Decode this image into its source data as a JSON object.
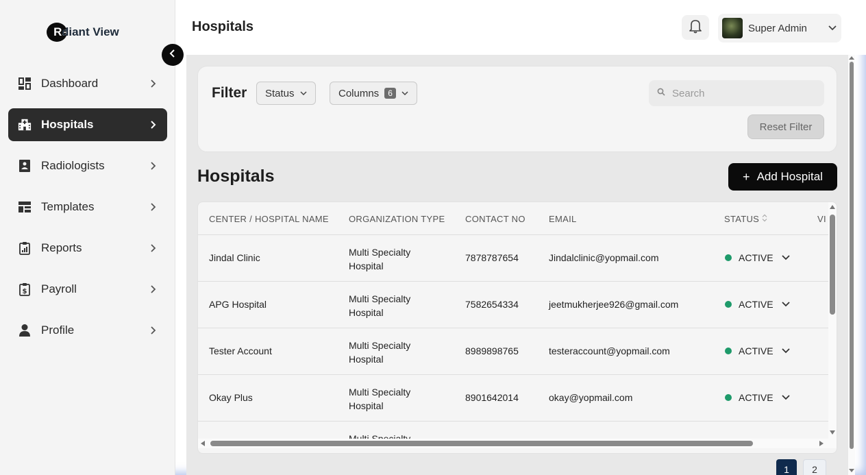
{
  "app": {
    "logo_badge": "Ra",
    "logo_rest": "diant View"
  },
  "sidebar": {
    "items": [
      {
        "label": "Dashboard",
        "icon": "dashboard-icon"
      },
      {
        "label": "Hospitals",
        "icon": "hospital-icon",
        "active": true
      },
      {
        "label": "Radiologists",
        "icon": "radiologist-icon"
      },
      {
        "label": "Templates",
        "icon": "templates-icon"
      },
      {
        "label": "Reports",
        "icon": "reports-icon"
      },
      {
        "label": "Payroll",
        "icon": "payroll-icon"
      },
      {
        "label": "Profile",
        "icon": "profile-icon"
      }
    ]
  },
  "header": {
    "title": "Hospitals",
    "user_name": "Super Admin"
  },
  "filter": {
    "title": "Filter",
    "status_label": "Status",
    "columns_label": "Columns",
    "columns_count": "6",
    "search_placeholder": "Search",
    "reset_label": "Reset Filter"
  },
  "section": {
    "title": "Hospitals",
    "add_label": "Add Hospital"
  },
  "table": {
    "columns": [
      "CENTER / HOSPITAL NAME",
      "ORGANIZATION TYPE",
      "CONTACT NO",
      "EMAIL",
      "STATUS",
      "VI"
    ],
    "rows": [
      {
        "name": "Jindal Clinic",
        "org": "Multi Specialty Hospital",
        "contact": "7878787654",
        "email": "Jindalclinic@yopmail.com",
        "status": "ACTIVE"
      },
      {
        "name": "APG Hospital",
        "org": "Multi Specialty Hospital",
        "contact": "7582654334",
        "email": "jeetmukherjee926@gmail.com",
        "status": "ACTIVE"
      },
      {
        "name": "Tester Account",
        "org": "Multi Specialty Hospital",
        "contact": "8989898765",
        "email": "testeraccount@yopmail.com",
        "status": "ACTIVE"
      },
      {
        "name": "Okay Plus",
        "org": "Multi Specialty Hospital",
        "contact": "8901642014",
        "email": "okay@yopmail.com",
        "status": "ACTIVE"
      },
      {
        "name": "",
        "org": "Multi Specialty",
        "contact": "",
        "email": "",
        "status": ""
      }
    ]
  },
  "pagination": {
    "pages": [
      "1",
      "2"
    ],
    "current": "1"
  },
  "colors": {
    "active_nav": "#2c2c2c",
    "status_active": "#1e9a6a",
    "primary_button": "#0b0b0b",
    "page_active": "#0f2a4d"
  }
}
